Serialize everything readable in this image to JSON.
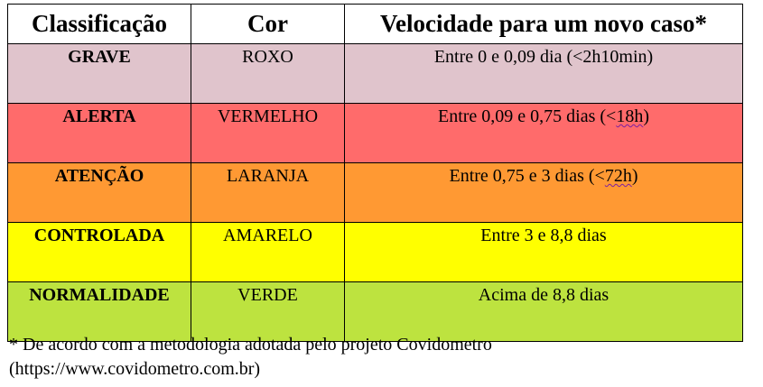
{
  "table": {
    "headers": [
      "Classificação",
      "Cor",
      "Velocidade para um novo caso*"
    ],
    "rows": [
      {
        "classificacao": "GRAVE",
        "cor": "ROXO",
        "vel_pre": "Entre 0 e 0,09 dia (<2h10min)",
        "vel_mark": "",
        "vel_post": "",
        "bg": "#e0c4cc"
      },
      {
        "classificacao": "ALERTA",
        "cor": "VERMELHO",
        "vel_pre": "Entre 0,09 e 0,75 dias (<",
        "vel_mark": "18h",
        "vel_post": ")",
        "bg": "#ff6b6b"
      },
      {
        "classificacao": "ATENÇÃO",
        "cor": "LARANJA",
        "vel_pre": "Entre 0,75 e 3 dias (<",
        "vel_mark": "72h",
        "vel_post": ")",
        "bg": "#ff9933"
      },
      {
        "classificacao": "CONTROLADA",
        "cor": "AMARELO",
        "vel_pre": "Entre 3 e 8,8 dias",
        "vel_mark": "",
        "vel_post": "",
        "bg": "#ffff00"
      },
      {
        "classificacao": "NORMALIDADE",
        "cor": "VERDE",
        "vel_pre": "Acima de 8,8 dias",
        "vel_mark": "",
        "vel_post": "",
        "bg": "#bde33f"
      }
    ]
  },
  "footnote": {
    "line1": "* De acordo com a metodologia adotada pelo projeto Covidometro",
    "line2": "(https://www.covidometro.com.br)"
  }
}
